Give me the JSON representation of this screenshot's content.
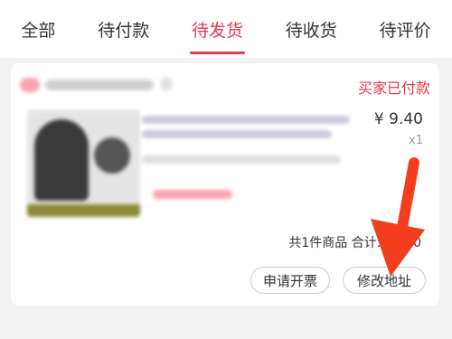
{
  "tabs": [
    {
      "label": "全部"
    },
    {
      "label": "待付款"
    },
    {
      "label": "待发货"
    },
    {
      "label": "待收货"
    },
    {
      "label": "待评价"
    }
  ],
  "order": {
    "status": "买家已付款",
    "price": "¥ 9.40",
    "quantity": "x1",
    "summary": "共1件商品 合计: ¥9.40"
  },
  "actions": {
    "invoice_label": "申请开票",
    "address_label": "修改地址"
  },
  "colors": {
    "accent": "#e8384f",
    "annotation_arrow": "#f23d1e"
  }
}
